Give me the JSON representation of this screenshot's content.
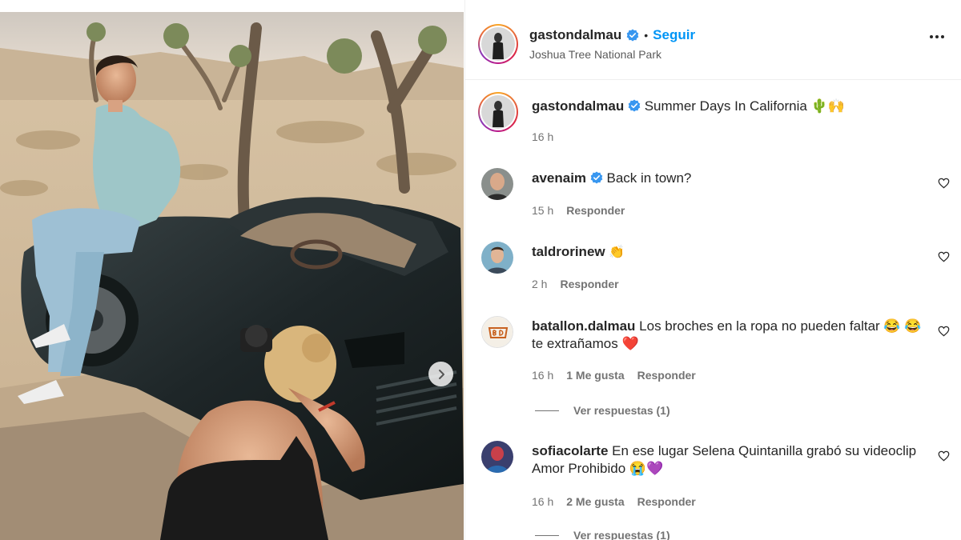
{
  "post": {
    "username": "gastondalmau",
    "follow_label": "Seguir",
    "separator": "•",
    "location": "Joshua Tree National Park",
    "caption": "Summer Days In California 🌵🙌",
    "caption_time": "16 h"
  },
  "comments": [
    {
      "username": "avenaim",
      "verified": true,
      "text": "Back in town?",
      "time": "15 h",
      "likes": "",
      "reply": "Responder",
      "view_replies": ""
    },
    {
      "username": "taldrorinew",
      "verified": false,
      "text": "👏",
      "time": "2 h",
      "likes": "",
      "reply": "Responder",
      "view_replies": ""
    },
    {
      "username": "batallon.dalmau",
      "verified": false,
      "text": "Los broches en la ropa no pueden faltar 😂 😂 te extrañamos ❤️",
      "time": "16 h",
      "likes": "1 Me gusta",
      "reply": "Responder",
      "view_replies": "Ver respuestas (1)"
    },
    {
      "username": "sofiacolarte",
      "verified": false,
      "text": "En ese lugar Selena Quintanilla grabó su videoclip Amor Prohibido 😭💜",
      "time": "16 h",
      "likes": "2 Me gusta",
      "reply": "Responder",
      "view_replies": "Ver respuestas (1)"
    }
  ],
  "icons": {
    "verified": "verified-badge-icon",
    "more": "more-options-icon",
    "heart": "heart-outline-icon",
    "next": "chevron-right-icon"
  },
  "colors": {
    "accent": "#0095f6",
    "verified": "#3897f0",
    "secondary_text": "#737373"
  }
}
